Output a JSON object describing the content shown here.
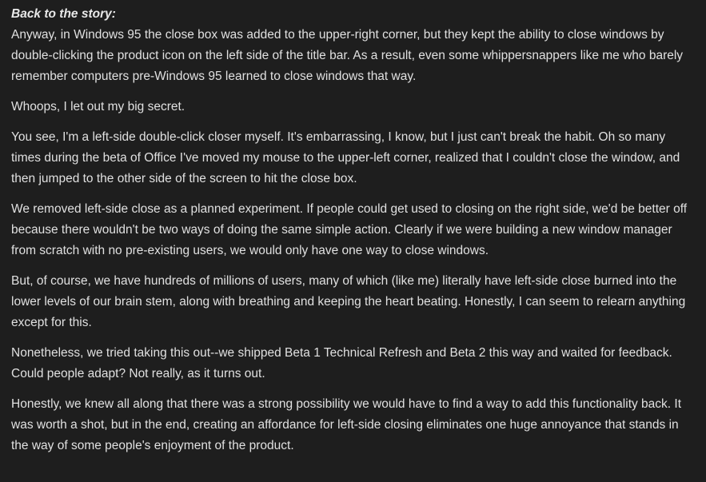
{
  "article": {
    "heading": "Back to the story:",
    "paragraphs": [
      "Anyway, in Windows 95 the close box was added to the upper-right corner, but they kept the ability to close windows by double-clicking the product icon on the left side of the title bar. As a result, even some whippersnappers like me who barely remember computers pre-Windows 95 learned to close windows that way.",
      "Whoops, I let out my big secret.",
      "You see, I'm a left-side double-click closer myself. It's embarrassing, I know, but I just can't break the habit. Oh so many times during the beta of Office I've moved my mouse to the upper-left corner, realized that I couldn't close the window, and then jumped to the other side of the screen to hit the close box.",
      "We removed left-side close as a planned experiment. If people could get used to closing on the right side, we'd be better off because there wouldn't be two ways of doing the same simple action. Clearly if we were building a new window manager from scratch with no pre-existing users, we would only have one way to close windows.",
      "But, of course, we have hundreds of millions of users, many of which (like me) literally have left-side close burned into the lower levels of our brain stem, along with breathing and keeping the heart beating. Honestly, I can seem to relearn anything except for this.",
      "Nonetheless, we tried taking this out--we shipped Beta 1 Technical Refresh and Beta 2 this way and waited for feedback. Could people adapt? Not really, as it turns out.",
      "Honestly, we knew all along that there was a strong possibility we would have to find a way to add this functionality back. It was worth a shot, but in the end, creating an affordance for left-side closing eliminates one huge annoyance that stands in the way of some people's enjoyment of the product."
    ]
  }
}
